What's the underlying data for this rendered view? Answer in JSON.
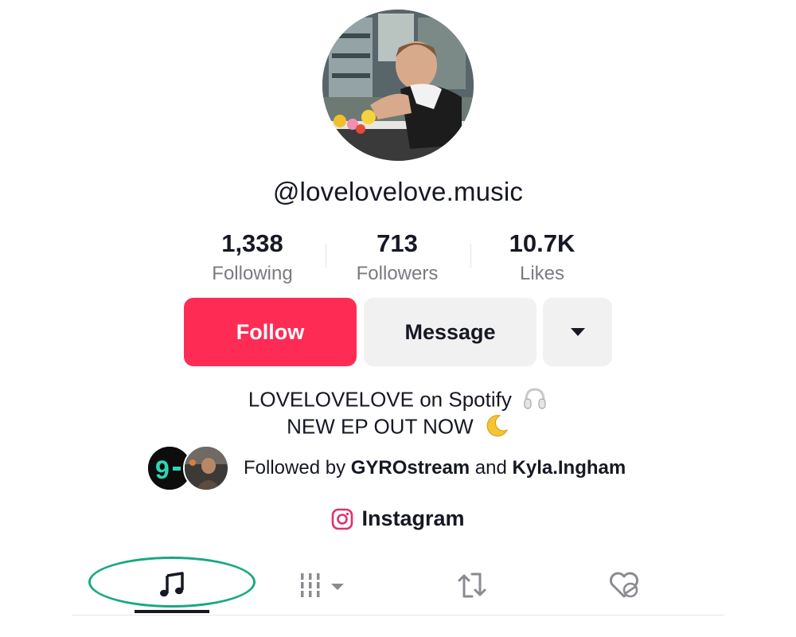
{
  "profile": {
    "handle": "@lovelovelove.music",
    "avatar_icon": "profile-photo"
  },
  "stats": [
    {
      "value": "1,338",
      "label": "Following"
    },
    {
      "value": "713",
      "label": "Followers"
    },
    {
      "value": "10.7K",
      "label": "Likes"
    }
  ],
  "actions": {
    "follow_label": "Follow",
    "message_label": "Message",
    "more_icon": "caret-down-icon"
  },
  "bio": {
    "line1": "LOVELOVELOVE on Spotify",
    "line1_emoji": "headphones-emoji",
    "line2": "NEW EP OUT NOW",
    "line2_emoji": "crescent-moon-emoji"
  },
  "followed_by": {
    "prefix": "Followed by",
    "user1": "GYROstream",
    "joiner": "and",
    "user2": "Kyla.Ingham"
  },
  "link": {
    "icon": "instagram-icon",
    "label": "Instagram"
  },
  "tabs": [
    {
      "name": "music-tab",
      "icon": "music-note-icon",
      "active": true
    },
    {
      "name": "videos-tab",
      "icon": "grid-icon"
    },
    {
      "name": "reposts-tab",
      "icon": "repost-icon"
    },
    {
      "name": "liked-tab",
      "icon": "heart-hidden-icon"
    }
  ],
  "colors": {
    "accent": "#fe2c55",
    "highlight": "#19a882"
  }
}
